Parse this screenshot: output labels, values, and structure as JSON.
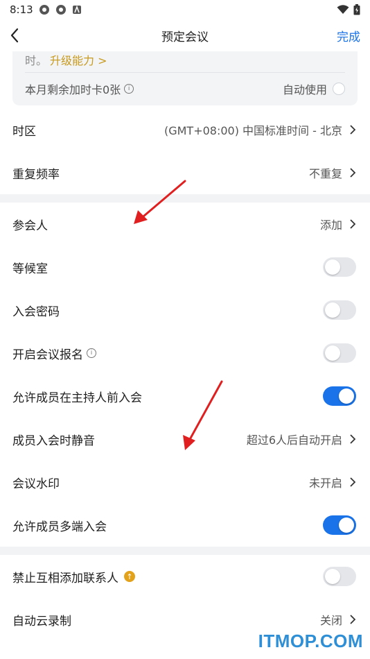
{
  "status_bar": {
    "time": "8:13"
  },
  "nav": {
    "title": "预定会议",
    "done_label": "完成"
  },
  "card": {
    "top_text": "时。",
    "upgrade_text": "升级能力 >",
    "remaining_label": "本月剩余加时卡0张",
    "auto_use_label": "自动使用"
  },
  "rows": {
    "timezone": {
      "label": "时区",
      "value": "(GMT+08:00) 中国标准时间 - 北京"
    },
    "repeat": {
      "label": "重复频率",
      "value": "不重复"
    },
    "participants": {
      "label": "参会人",
      "value": "添加"
    },
    "waiting_room": {
      "label": "等候室",
      "enabled": false
    },
    "password": {
      "label": "入会密码",
      "enabled": false
    },
    "registration": {
      "label": "开启会议报名",
      "enabled": false
    },
    "join_before_host": {
      "label": "允许成员在主持人前入会",
      "enabled": true
    },
    "mute_on_join": {
      "label": "成员入会时静音",
      "value": "超过6人后自动开启"
    },
    "watermark": {
      "label": "会议水印",
      "value": "未开启"
    },
    "multi_device": {
      "label": "允许成员多端入会",
      "enabled": true
    },
    "forbid_contacts": {
      "label": "禁止互相添加联系人",
      "enabled": false
    },
    "cloud_record": {
      "label": "自动云录制",
      "value": "关闭"
    }
  },
  "watermark_text": "ITMOP.COM",
  "colors": {
    "accent": "#1a73e8",
    "upgrade": "#c79a1e",
    "annotation_arrow": "#e02020"
  }
}
